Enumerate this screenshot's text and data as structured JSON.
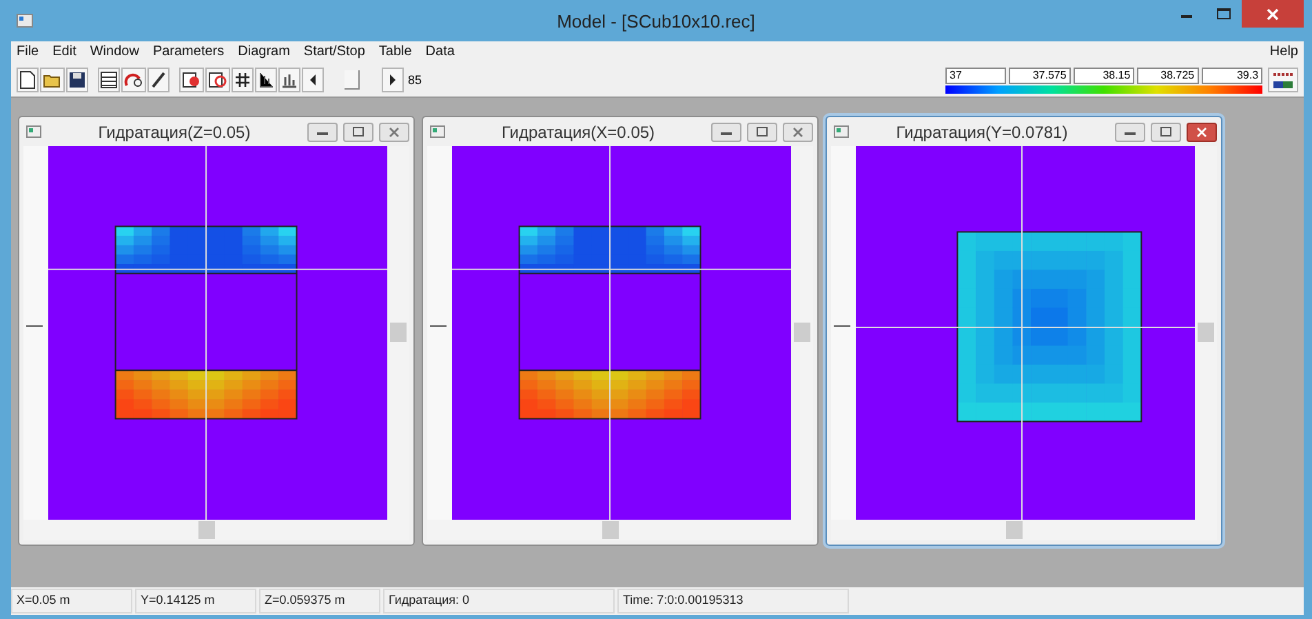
{
  "window": {
    "title": "Model - [SCub10x10.rec]"
  },
  "menu": [
    {
      "label": "File"
    },
    {
      "label": "Edit"
    },
    {
      "label": "Window"
    },
    {
      "label": "Parameters"
    },
    {
      "label": "Diagram"
    },
    {
      "label": "Start/Stop"
    },
    {
      "label": "Table"
    },
    {
      "label": "Data"
    }
  ],
  "help": "Help",
  "toolbar": {
    "slider": {
      "level": 0.45
    },
    "step_value": "85"
  },
  "legend": {
    "labels": [
      "37",
      "37.575",
      "38.15",
      "38.725",
      "39.3"
    ]
  },
  "views": [
    {
      "title": "Гидратация(Z=0.05)",
      "selected": false,
      "kind": "bands"
    },
    {
      "title": "Гидратация(X=0.05)",
      "selected": false,
      "kind": "bands"
    },
    {
      "title": "Гидратация(Y=0.0781)",
      "selected": true,
      "kind": "square"
    }
  ],
  "status_bar": [
    "X=0.05 m",
    "Y=0.14125 m",
    "Z=0.059375 m",
    "Гидратация:  0",
    "Time: 7:0:0.00195313"
  ]
}
